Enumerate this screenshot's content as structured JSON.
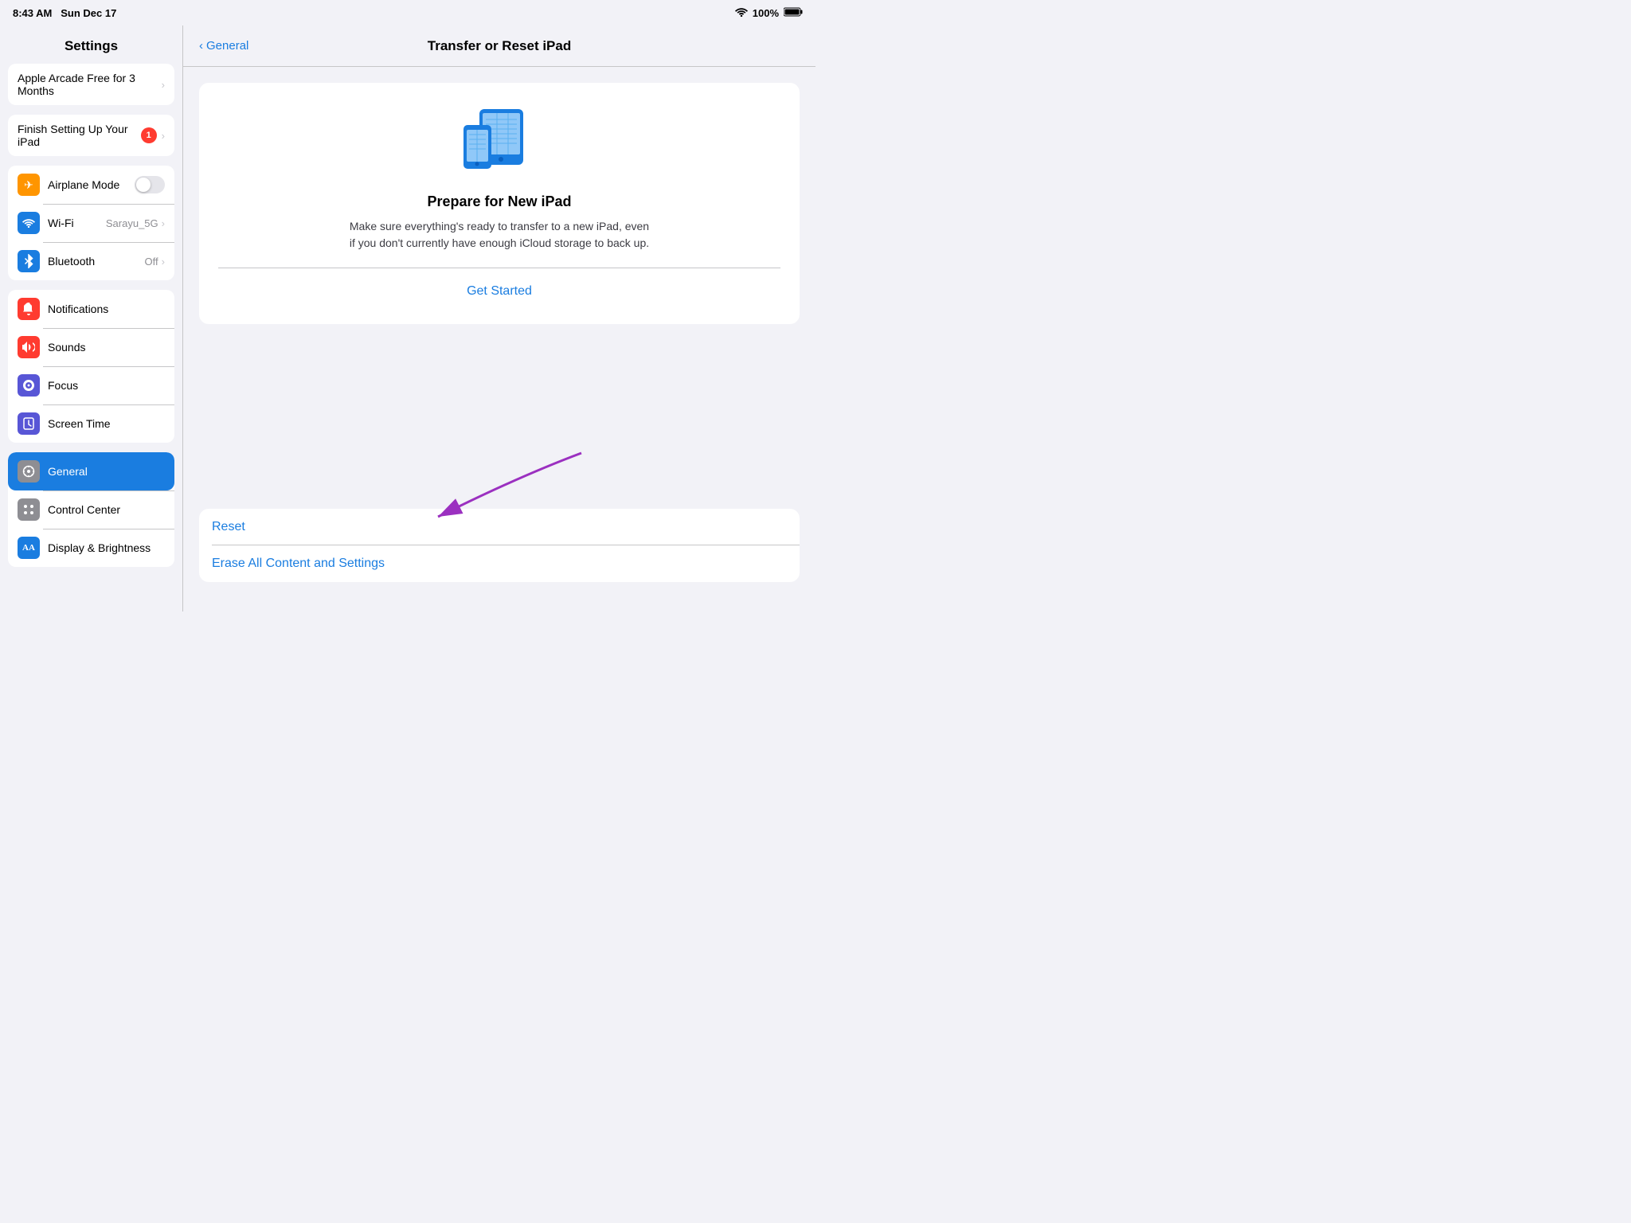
{
  "statusBar": {
    "time": "8:43 AM",
    "date": "Sun Dec 17",
    "battery": "100%"
  },
  "sidebar": {
    "title": "Settings",
    "groups": [
      {
        "id": "promo",
        "items": [
          {
            "id": "arcade",
            "label": "Apple Arcade Free for 3 Months",
            "icon": null,
            "iconBg": null,
            "showChevron": true
          }
        ]
      },
      {
        "id": "setup",
        "items": [
          {
            "id": "finish-setup",
            "label": "Finish Setting Up Your iPad",
            "icon": null,
            "iconBg": null,
            "showChevron": true,
            "badge": "1"
          }
        ]
      },
      {
        "id": "connectivity",
        "items": [
          {
            "id": "airplane",
            "label": "Airplane Mode",
            "icon": "✈",
            "iconBg": "#ff9500",
            "showToggle": true
          },
          {
            "id": "wifi",
            "label": "Wi-Fi",
            "icon": "wifi",
            "iconBg": "#1a7de0",
            "value": "Sarayu_5G",
            "showChevron": true
          },
          {
            "id": "bluetooth",
            "label": "Bluetooth",
            "icon": "bt",
            "iconBg": "#1a7de0",
            "value": "Off",
            "showChevron": true
          }
        ]
      },
      {
        "id": "system",
        "items": [
          {
            "id": "notifications",
            "label": "Notifications",
            "icon": "bell",
            "iconBg": "#ff3b30",
            "showChevron": false
          },
          {
            "id": "sounds",
            "label": "Sounds",
            "icon": "sound",
            "iconBg": "#ff3b30",
            "showChevron": false
          },
          {
            "id": "focus",
            "label": "Focus",
            "icon": "moon",
            "iconBg": "#5856d6",
            "showChevron": false
          },
          {
            "id": "screen-time",
            "label": "Screen Time",
            "icon": "hourglass",
            "iconBg": "#5856d6",
            "showChevron": false
          }
        ]
      },
      {
        "id": "device",
        "items": [
          {
            "id": "general",
            "label": "General",
            "icon": "gear",
            "iconBg": "#8e8e93",
            "showChevron": false,
            "active": true
          },
          {
            "id": "control-center",
            "label": "Control Center",
            "icon": "sliders",
            "iconBg": "#8e8e93",
            "showChevron": false
          },
          {
            "id": "display",
            "label": "Display & Brightness",
            "icon": "AA",
            "iconBg": "#1a7de0",
            "showChevron": false
          }
        ]
      }
    ]
  },
  "content": {
    "backLabel": "General",
    "title": "Transfer or Reset iPad",
    "prepareCard": {
      "title": "Prepare for New iPad",
      "description": "Make sure everything's ready to transfer to a new iPad, even if you don't currently have enough iCloud storage to back up.",
      "getStartedLabel": "Get Started"
    },
    "resetSection": {
      "items": [
        {
          "id": "reset",
          "label": "Reset",
          "color": "blue"
        },
        {
          "id": "erase",
          "label": "Erase All Content and Settings",
          "color": "blue"
        }
      ]
    }
  }
}
